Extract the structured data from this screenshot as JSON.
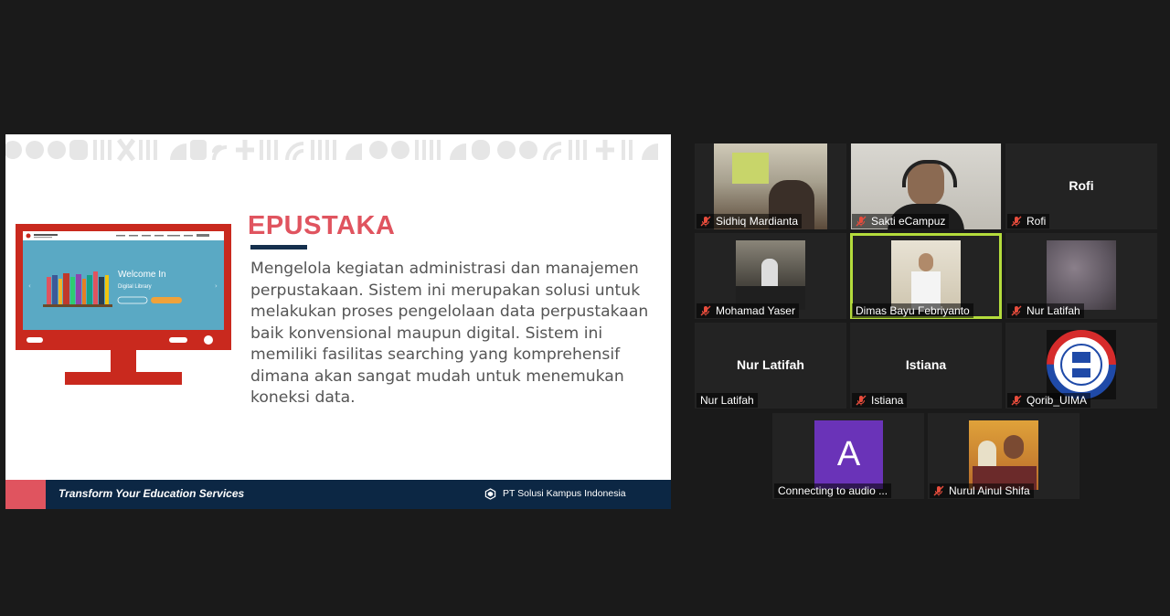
{
  "slide": {
    "title": "EPUSTAKA",
    "body": "Mengelola kegiatan administrasi dan manajemen perpustakaan. Sistem ini merupakan solusi untuk melakukan proses pengelolaan data perpustakaan baik konvensional maupun digital. Sistem ini memiliki fasilitas searching yang komprehensif dimana akan sangat mudah untuk menemukan koneksi data.",
    "tagline": "Transform Your Education Services",
    "company": "PT Solusi Kampus Indonesia",
    "monitor": {
      "welcome": "Welcome In",
      "subtitle": "Digital Library",
      "brand": "DIGITAL LIBRARY"
    }
  },
  "colors": {
    "accent_red": "#e0545f",
    "navy": "#0c2744",
    "active_speaker_border": "#b4dc3c",
    "avatar_purple": "#6a33b8"
  },
  "participants": [
    {
      "name": "Sidhiq Mardianta",
      "muted": true,
      "display": "video"
    },
    {
      "name": "Sakti eCampuz",
      "muted": true,
      "display": "video"
    },
    {
      "name": "Rofi",
      "muted": true,
      "display": "name",
      "center_name": "Rofi"
    },
    {
      "name": "Mohamad Yaser",
      "muted": true,
      "display": "video"
    },
    {
      "name": "Dimas Bayu Febriyanto",
      "muted": false,
      "display": "video",
      "active_speaker": true
    },
    {
      "name": "Nur Latifah",
      "muted": true,
      "display": "video"
    },
    {
      "name": "Nur Latifah",
      "muted": false,
      "display": "name",
      "center_name": "Nur Latifah"
    },
    {
      "name": "Istiana",
      "muted": true,
      "display": "name",
      "center_name": "Istiana"
    },
    {
      "name": "Qorib_UIMA",
      "muted": true,
      "display": "logo"
    },
    {
      "name": "Connecting to audio ...",
      "muted": false,
      "display": "avatar",
      "avatar_letter": "A"
    },
    {
      "name": "Nurul Ainul Shifa",
      "muted": true,
      "display": "video"
    }
  ]
}
